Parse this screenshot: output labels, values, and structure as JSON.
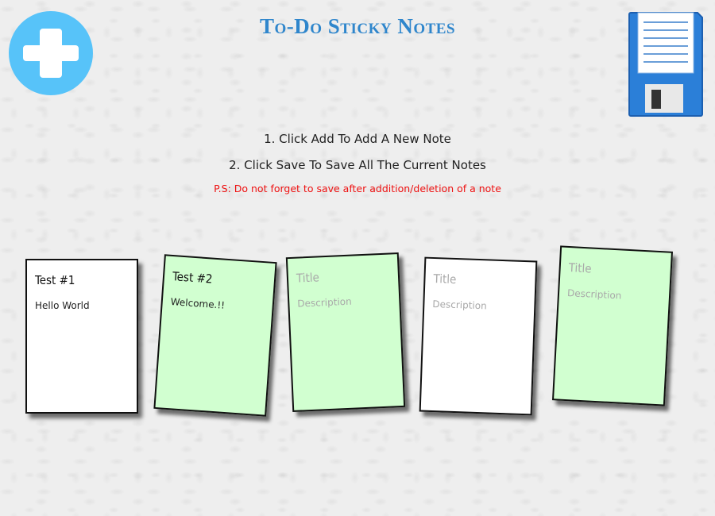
{
  "header": {
    "title": "To-Do Sticky Notes"
  },
  "instructions": {
    "step1": "1. Click Add To Add A New Note",
    "step2": "2. Click Save To Save All The Current Notes",
    "ps": "P.S: Do not forget to save after addition/deletion of a note"
  },
  "controls": {
    "add_icon": "plus-icon",
    "save_icon": "floppy-disk-icon",
    "add_color": "#57c3f9",
    "save_color": "#2b7fd8"
  },
  "notes": [
    {
      "title": "Test #1",
      "description": "Hello World",
      "color": "white"
    },
    {
      "title": "Test #2",
      "description": "Welcome.!!",
      "color": "green"
    },
    {
      "title_placeholder": "Title",
      "description_placeholder": "Description",
      "color": "green"
    },
    {
      "title_placeholder": "Title",
      "description_placeholder": "Description",
      "color": "white"
    },
    {
      "title_placeholder": "Title",
      "description_placeholder": "Description",
      "color": "green"
    }
  ]
}
